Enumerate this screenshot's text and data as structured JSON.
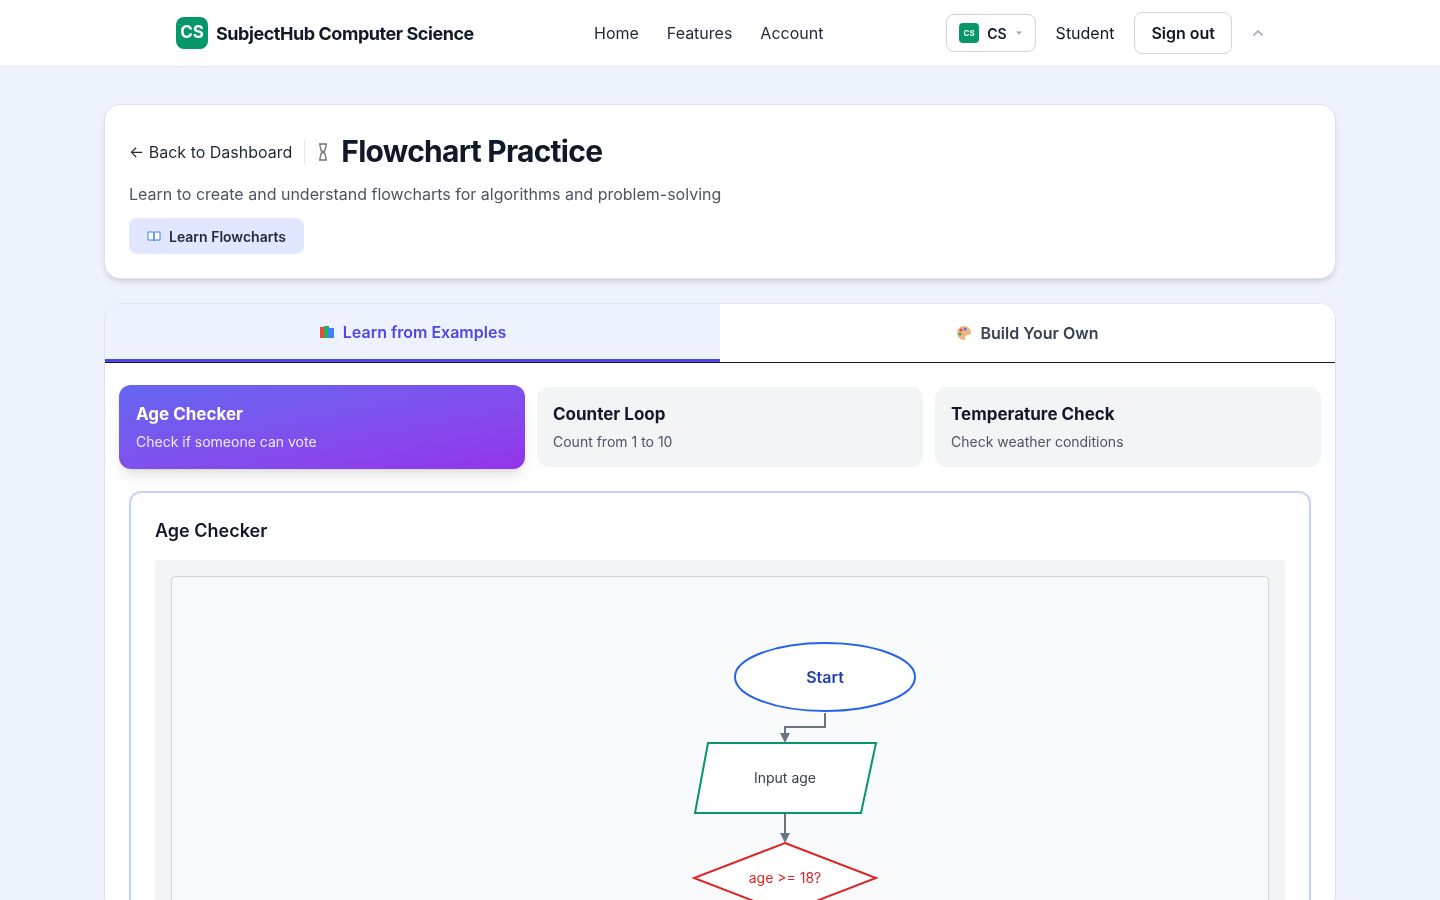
{
  "header": {
    "logo": "CS",
    "brand": "SubjectHub Computer Science",
    "nav": [
      "Home",
      "Features",
      "Account"
    ],
    "subject": {
      "badge": "CS",
      "label": "CS"
    },
    "role": "Student",
    "sign_out": "Sign out"
  },
  "intro": {
    "back": "← Back to Dashboard",
    "title": "Flowchart Practice",
    "subtitle": "Learn to create and understand flowcharts for algorithms and problem-solving",
    "learn_button": "Learn Flowcharts"
  },
  "tabs": [
    {
      "label": "Learn from Examples",
      "selected": true
    },
    {
      "label": "Build Your Own",
      "selected": false
    }
  ],
  "examples": [
    {
      "title": "Age Checker",
      "subtitle": "Check if someone can vote",
      "selected": true
    },
    {
      "title": "Counter Loop",
      "subtitle": "Count from 1 to 10",
      "selected": false
    },
    {
      "title": "Temperature Check",
      "subtitle": "Check weather conditions",
      "selected": false
    }
  ],
  "panel": {
    "title": "Age Checker",
    "nodes": [
      {
        "kind": "terminal",
        "text": "Start"
      },
      {
        "kind": "io",
        "text": "Input age"
      },
      {
        "kind": "decision",
        "text": "age >= 18?"
      }
    ]
  }
}
